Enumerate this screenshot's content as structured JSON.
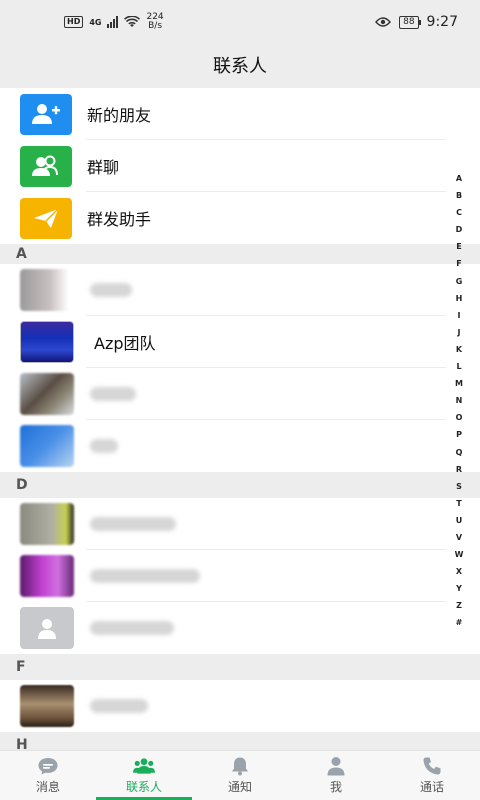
{
  "status_bar": {
    "hd": "HD",
    "net": "4G",
    "speed_value": "224",
    "speed_unit": "B/s",
    "battery": "88",
    "time": "9:27"
  },
  "nav": {
    "title": "联系人"
  },
  "functions": [
    {
      "label": "新的朋友",
      "icon": "add-friend-icon",
      "color": "#1f8ef1"
    },
    {
      "label": "群聊",
      "icon": "group-chat-icon",
      "color": "#27b148"
    },
    {
      "label": "群发助手",
      "icon": "broadcast-icon",
      "color": "#f6b400"
    }
  ],
  "sections": [
    {
      "letter": "A",
      "contacts": [
        {
          "name": "",
          "blurred": true
        },
        {
          "name": "Azp团队",
          "blurred": false
        },
        {
          "name": "",
          "blurred": true
        },
        {
          "name": "",
          "blurred": true
        }
      ]
    },
    {
      "letter": "D",
      "contacts": [
        {
          "name": "",
          "blurred": true
        },
        {
          "name": "",
          "blurred": true
        },
        {
          "name": "",
          "blurred": true
        }
      ]
    },
    {
      "letter": "F",
      "contacts": [
        {
          "name": "",
          "blurred": true
        }
      ]
    },
    {
      "letter": "H",
      "contacts": []
    }
  ],
  "index_letters": [
    "A",
    "B",
    "C",
    "D",
    "E",
    "F",
    "G",
    "H",
    "I",
    "J",
    "K",
    "L",
    "M",
    "N",
    "O",
    "P",
    "Q",
    "R",
    "S",
    "T",
    "U",
    "V",
    "W",
    "X",
    "Y",
    "Z",
    "#"
  ],
  "tabs": [
    {
      "label": "消息",
      "icon": "message-icon",
      "active": false
    },
    {
      "label": "联系人",
      "icon": "contacts-icon",
      "active": true
    },
    {
      "label": "通知",
      "icon": "bell-icon",
      "active": false
    },
    {
      "label": "我",
      "icon": "profile-icon",
      "active": false
    },
    {
      "label": "通话",
      "icon": "phone-icon",
      "active": false
    }
  ],
  "colors": {
    "accent": "#1aad5a",
    "background": "#ededed"
  }
}
